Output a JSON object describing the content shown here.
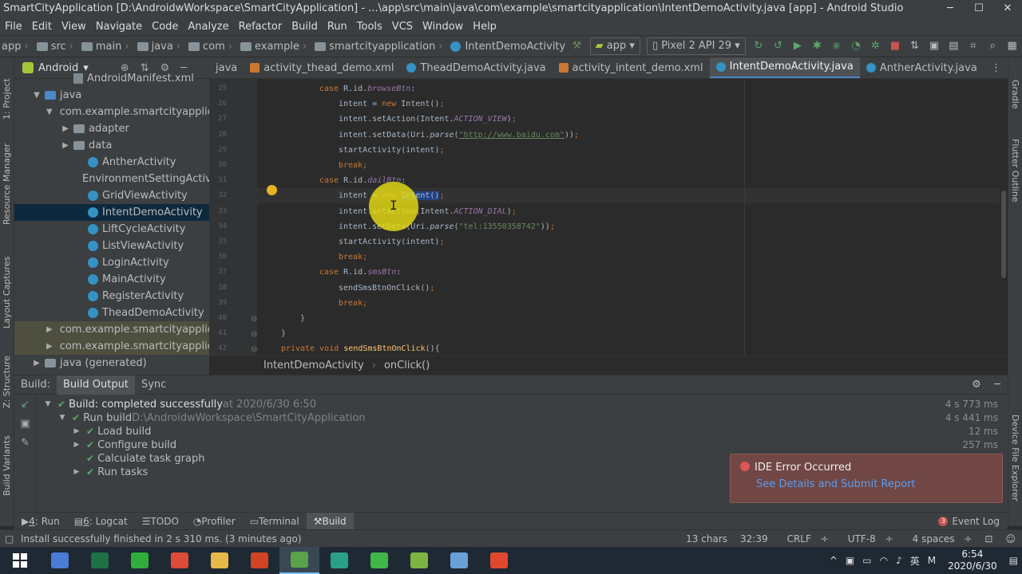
{
  "window": {
    "title": "SmartCityApplication [D:\\AndroidwWorkspace\\SmartCityApplication] - ...\\app\\src\\main\\java\\com\\example\\smartcityapplication\\IntentDemoActivity.java [app] - Android Studio"
  },
  "menu": [
    "File",
    "Edit",
    "View",
    "Navigate",
    "Code",
    "Analyze",
    "Refactor",
    "Build",
    "Run",
    "Tools",
    "VCS",
    "Window",
    "Help"
  ],
  "navbar": {
    "crumbs": [
      "app",
      "src",
      "main",
      "java",
      "com",
      "example",
      "smartcityapplication"
    ],
    "current_class": "IntentDemoActivity",
    "run_config": "app",
    "device": "Pixel 2 API 29"
  },
  "project_panel": {
    "view_mode": "Android",
    "tree": [
      {
        "label": "AndroidManifest.xml",
        "indent": 3,
        "icon": "manifest",
        "arrow": ""
      },
      {
        "label": "java",
        "indent": 1,
        "icon": "folder-blue",
        "arrow": "down"
      },
      {
        "label": "com.example.smartcityapplic",
        "indent": 2,
        "icon": "folder",
        "arrow": "down"
      },
      {
        "label": "adapter",
        "indent": 3,
        "icon": "folder",
        "arrow": "right"
      },
      {
        "label": "data",
        "indent": 3,
        "icon": "folder",
        "arrow": "right"
      },
      {
        "label": "AntherActivity",
        "indent": 4,
        "icon": "class",
        "arrow": ""
      },
      {
        "label": "EnvironmentSettingActivit",
        "indent": 4,
        "icon": "class",
        "arrow": ""
      },
      {
        "label": "GridViewActivity",
        "indent": 4,
        "icon": "class",
        "arrow": ""
      },
      {
        "label": "IntentDemoActivity",
        "indent": 4,
        "icon": "class",
        "arrow": "",
        "selected": true
      },
      {
        "label": "LiftCycleActivity",
        "indent": 4,
        "icon": "class",
        "arrow": ""
      },
      {
        "label": "ListViewActivity",
        "indent": 4,
        "icon": "class",
        "arrow": ""
      },
      {
        "label": "LoginActivity",
        "indent": 4,
        "icon": "class",
        "arrow": ""
      },
      {
        "label": "MainActivity",
        "indent": 4,
        "icon": "class",
        "arrow": ""
      },
      {
        "label": "RegisterActivity",
        "indent": 4,
        "icon": "class",
        "arrow": ""
      },
      {
        "label": "TheadDemoActivity",
        "indent": 4,
        "icon": "class",
        "arrow": ""
      },
      {
        "label": "com.example.smartcityapplic",
        "indent": 2,
        "icon": "folder",
        "arrow": "right",
        "modified": true
      },
      {
        "label": "com.example.smartcityapplic",
        "indent": 2,
        "icon": "folder",
        "arrow": "right",
        "modified": true
      },
      {
        "label": "java (generated)",
        "indent": 1,
        "icon": "folder",
        "arrow": "right"
      }
    ]
  },
  "stripes": {
    "left": [
      "1: Project",
      "Resource Manager",
      "Layout Captures",
      "Z: Structure",
      "Build Variants"
    ],
    "right": [
      "Gradle",
      "Flutter Outline",
      "Device File Explorer"
    ]
  },
  "tabs": [
    {
      "label": "java",
      "type": "java"
    },
    {
      "label": "activity_thead_demo.xml",
      "type": "xml"
    },
    {
      "label": "TheadDemoActivity.java",
      "type": "java"
    },
    {
      "label": "activity_intent_demo.xml",
      "type": "xml"
    },
    {
      "label": "IntentDemoActivity.java",
      "type": "java",
      "active": true
    },
    {
      "label": "AntherActivity.java",
      "type": "java"
    }
  ],
  "code_lines": [
    {
      "n": "25",
      "indent": 3,
      "tokens": [
        [
          "kw",
          "case "
        ],
        [
          "",
          "R.id."
        ],
        [
          "fld",
          "browseBtn"
        ],
        [
          "",
          ":"
        ]
      ]
    },
    {
      "n": "26",
      "indent": 4,
      "tokens": [
        [
          "",
          "intent = "
        ],
        [
          "kw",
          "new "
        ],
        [
          "",
          "Intent()"
        ],
        [
          "kw",
          ";"
        ]
      ]
    },
    {
      "n": "27",
      "indent": 4,
      "tokens": [
        [
          "",
          "intent.setAction(Intent."
        ],
        [
          "fld",
          "ACTION_VIEW"
        ],
        [
          "",
          ")"
        ],
        [
          "kw",
          ";"
        ]
      ]
    },
    {
      "n": "28",
      "indent": 4,
      "tokens": [
        [
          "",
          "intent.setData(Uri."
        ],
        [
          "itl",
          "parse"
        ],
        [
          "",
          "("
        ],
        [
          "str",
          "\"http://www.baidu.com\""
        ],
        [
          "",
          "))"
        ],
        [
          "kw",
          ";"
        ]
      ]
    },
    {
      "n": "29",
      "indent": 4,
      "tokens": [
        [
          "",
          "startActivity(intent)"
        ],
        [
          "kw",
          ";"
        ]
      ]
    },
    {
      "n": "30",
      "indent": 4,
      "tokens": [
        [
          "kw",
          "break;"
        ]
      ]
    },
    {
      "n": "31",
      "indent": 3,
      "tokens": [
        [
          "kw",
          "case "
        ],
        [
          "",
          "R.id."
        ],
        [
          "fld",
          "dailBtn"
        ],
        [
          "",
          ":"
        ]
      ]
    },
    {
      "n": "32",
      "indent": 4,
      "current": true,
      "tokens": [
        [
          "",
          "intent = "
        ],
        [
          "kw",
          "new "
        ],
        [
          "sel",
          "Intent()"
        ],
        [
          "kw",
          ";"
        ]
      ]
    },
    {
      "n": "33",
      "indent": 4,
      "tokens": [
        [
          "",
          "intent.setAction(Intent."
        ],
        [
          "fld",
          "ACTION_DIAL"
        ],
        [
          "",
          ")"
        ],
        [
          "kw",
          ";"
        ]
      ]
    },
    {
      "n": "34",
      "indent": 4,
      "tokens": [
        [
          "",
          "intent.setData(Uri."
        ],
        [
          "itl",
          "parse"
        ],
        [
          "",
          "("
        ],
        [
          "str2",
          "\"tel:13550358742\""
        ],
        [
          "",
          "))"
        ],
        [
          "kw",
          ";"
        ]
      ]
    },
    {
      "n": "35",
      "indent": 4,
      "tokens": [
        [
          "",
          "startActivity(intent)"
        ],
        [
          "kw",
          ";"
        ]
      ]
    },
    {
      "n": "36",
      "indent": 4,
      "tokens": [
        [
          "kw",
          "break;"
        ]
      ]
    },
    {
      "n": "37",
      "indent": 3,
      "tokens": [
        [
          "kw",
          "case "
        ],
        [
          "",
          "R.id."
        ],
        [
          "fld",
          "smsBtn"
        ],
        [
          "",
          ":"
        ]
      ]
    },
    {
      "n": "38",
      "indent": 4,
      "tokens": [
        [
          "",
          "sendSmsBtnOnClick()"
        ],
        [
          "kw",
          ";"
        ]
      ]
    },
    {
      "n": "39",
      "indent": 4,
      "tokens": [
        [
          "kw",
          "break;"
        ]
      ]
    },
    {
      "n": "40",
      "indent": 2,
      "tokens": [
        [
          "",
          "}"
        ]
      ]
    },
    {
      "n": "41",
      "indent": 1,
      "tokens": [
        [
          "",
          "}"
        ]
      ]
    },
    {
      "n": "42",
      "indent": 1,
      "tokens": [
        [
          "kw",
          "private void "
        ],
        [
          "mth",
          "sendSmsBtnOnClick"
        ],
        [
          "",
          "(){"
        ]
      ]
    }
  ],
  "editor_breadcrumb": [
    "IntentDemoActivity",
    "onClick()"
  ],
  "build": {
    "label": "Build:",
    "tabs": [
      "Build Output",
      "Sync"
    ],
    "rows": [
      {
        "indent": 0,
        "arrow": "down",
        "check": true,
        "text": "Build: completed successfully",
        "dim": " at 2020/6/30 6:50",
        "bold": true,
        "time": "4 s 773 ms"
      },
      {
        "indent": 1,
        "arrow": "down",
        "check": true,
        "text": "Run build",
        "dim": " D:\\AndroidwWorkspace\\SmartCityApplication",
        "time": "4 s 441 ms"
      },
      {
        "indent": 2,
        "arrow": "right",
        "check": true,
        "text": "Load build",
        "dim": "",
        "time": "12 ms"
      },
      {
        "indent": 2,
        "arrow": "right",
        "check": true,
        "text": "Configure build",
        "dim": "",
        "time": "257 ms"
      },
      {
        "indent": 2,
        "arrow": "",
        "check": true,
        "text": "Calculate task graph",
        "dim": "",
        "time": ""
      },
      {
        "indent": 2,
        "arrow": "right",
        "check": true,
        "text": "Run tasks",
        "dim": "",
        "time": ""
      }
    ]
  },
  "error_balloon": {
    "title": "IDE Error Occurred",
    "link": "See Details and Submit Report"
  },
  "bottom_tools": [
    {
      "key": "4",
      "label": ": Run"
    },
    {
      "key": "6",
      "label": ": Logcat"
    },
    {
      "key": "",
      "label": "TODO"
    },
    {
      "key": "",
      "label": "Profiler"
    },
    {
      "key": "",
      "label": "Terminal"
    },
    {
      "key": "",
      "label": "Build",
      "active": true
    }
  ],
  "event_log": {
    "label": "Event Log",
    "count": "3"
  },
  "status": {
    "message": "Install successfully finished in 2 s 310 ms. (3 minutes ago)",
    "chars": "13 chars",
    "position": "32:39",
    "line_sep": "CRLF",
    "encoding": "UTF-8",
    "indent": "4 spaces"
  },
  "taskbar": {
    "apps": [
      {
        "name": "feather-app",
        "color": "#4a7cd6"
      },
      {
        "name": "excel",
        "color": "#1e7145"
      },
      {
        "name": "browser-360",
        "color": "#2fae3c"
      },
      {
        "name": "chrome",
        "color": "#dd4b39"
      },
      {
        "name": "file-explorer",
        "color": "#e8b84a"
      },
      {
        "name": "powerpoint",
        "color": "#d04423"
      },
      {
        "name": "android-studio",
        "color": "#5aa34a",
        "active": true
      },
      {
        "name": "teal-app",
        "color": "#2aa08a"
      },
      {
        "name": "green-c-app",
        "color": "#41b649"
      },
      {
        "name": "notepad-plus",
        "color": "#7cb342"
      },
      {
        "name": "blue-app",
        "color": "#6aa0d8"
      },
      {
        "name": "red-c-app",
        "color": "#e0492f"
      }
    ],
    "ime": "英",
    "time": "6:54",
    "date": "2020/6/30"
  },
  "colors": {
    "accent": "#4a88c7",
    "success": "#59a869",
    "error_bg": "#704745",
    "link": "#589df6"
  }
}
